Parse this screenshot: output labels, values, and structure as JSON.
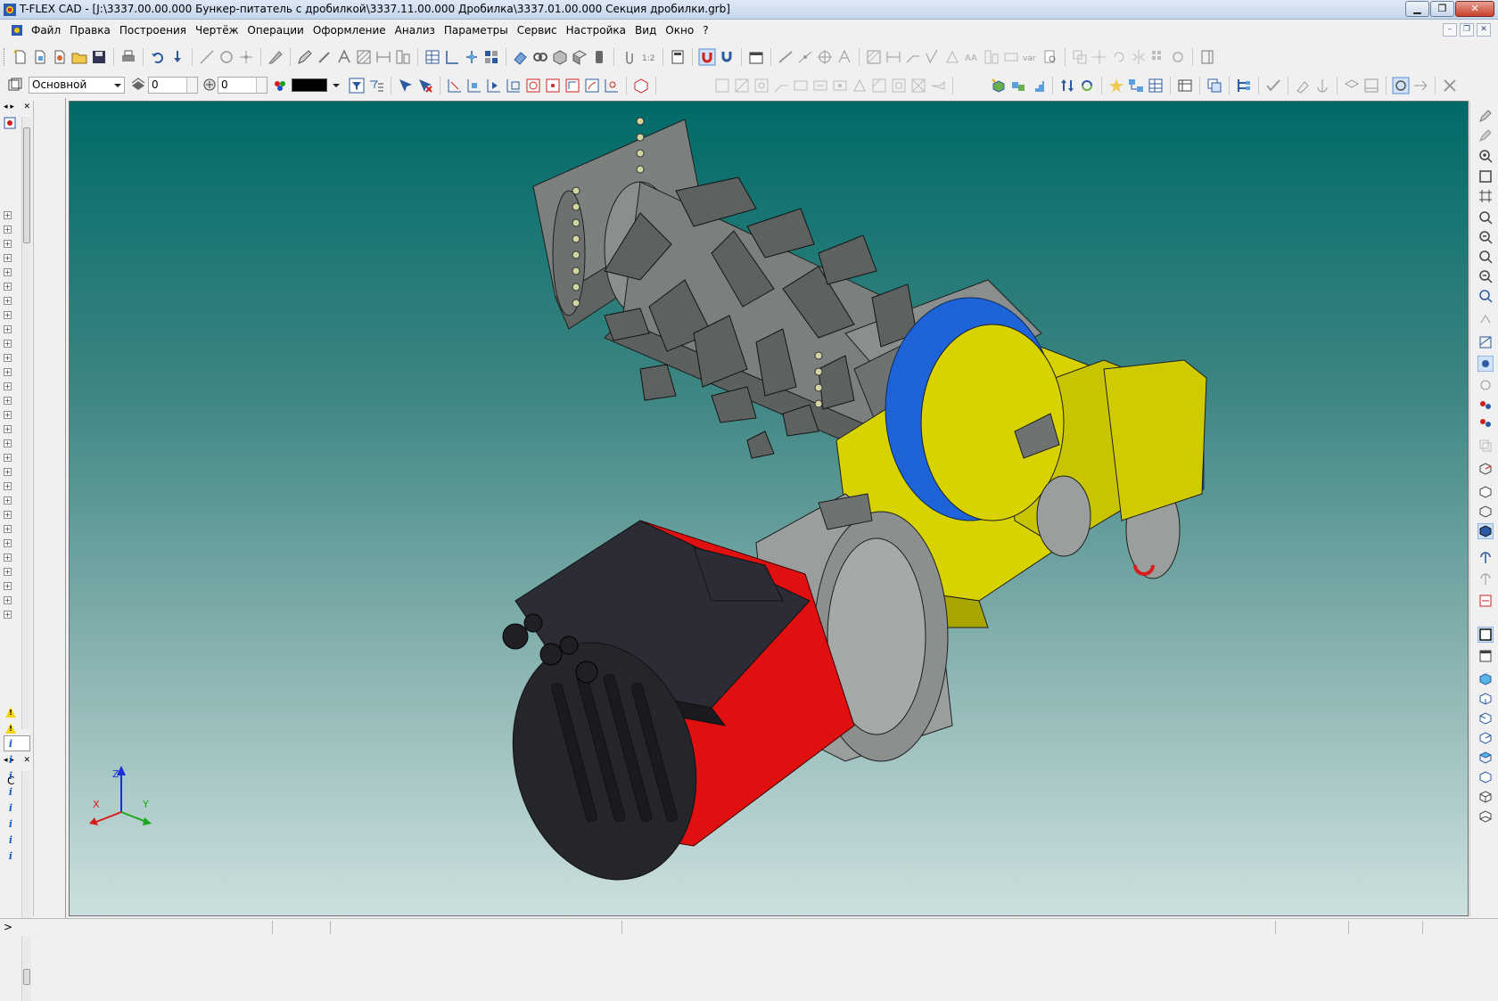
{
  "window": {
    "title": "T-FLEX CAD - [J:\\3337.00.00.000 Бункер-питатель с дробилкой\\3337.11.00.000 Дробилка\\3337.01.00.000 Секция дробилки.grb]"
  },
  "menu": {
    "items": [
      "Файл",
      "Правка",
      "Построения",
      "Чертёж",
      "Операции",
      "Оформление",
      "Анализ",
      "Параметры",
      "Сервис",
      "Настройка",
      "Вид",
      "Окно",
      "?"
    ]
  },
  "toolbar": {
    "layer_value": "Основной",
    "level_value": "0",
    "priority_value": "0",
    "color_value": "#000000"
  },
  "messages": {
    "header": "С"
  },
  "axes": {
    "x_label": "X",
    "y_label": "Y",
    "z_label": "Z"
  },
  "statusbar": {
    "text": ">"
  },
  "colors": {
    "viewport_top": "#006a67",
    "viewport_bottom": "#cde0df",
    "motor_red": "#e01010",
    "gearbox_yellow": "#d7d200",
    "gear_blue": "#1e64d8",
    "steel_grey": "#8c918f"
  }
}
